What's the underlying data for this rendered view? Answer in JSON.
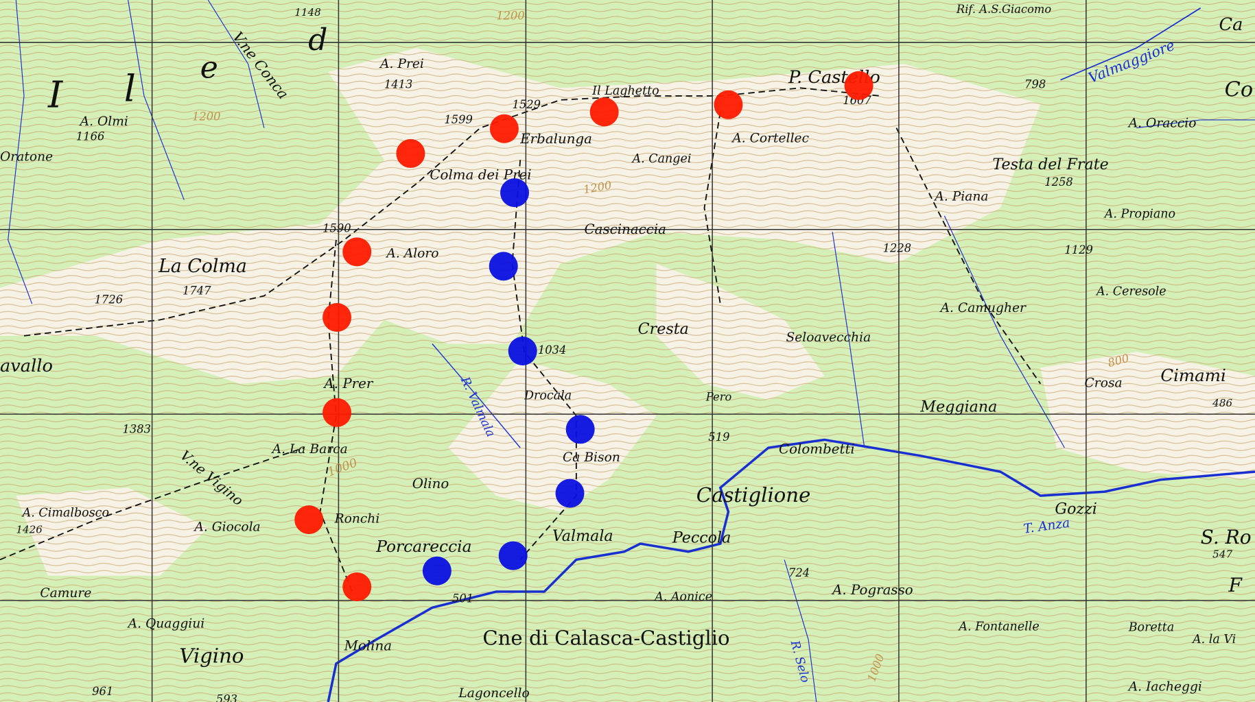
{
  "map": {
    "colors": {
      "land": "#d4f0b8",
      "rock": "#f6f3e6",
      "contour": "#c9a36a",
      "water": "#1a2fd0",
      "grid": "#333333",
      "marker_red": "#ff1a00",
      "marker_blue": "#0a10e0"
    },
    "markers_red_count": 10,
    "markers_blue_count": 7,
    "labels": [
      "I",
      "l",
      "e",
      "d",
      "V.ne Conca",
      "1148",
      "A. Prei",
      "1413",
      "1200",
      "1200",
      "A. Olmi",
      "1166",
      "Oratone",
      "Il Laghetto",
      "1529",
      "1599",
      "Erbalunga",
      "Colma dei Prei",
      "A. Cangei",
      "A. Cortellec",
      "P. Castello",
      "1607",
      "798",
      "Valmaggiore",
      "Ca",
      "Co",
      "Rif. A.S.Giacomo",
      "A. Oraccio",
      "Testa del Frate",
      "1258",
      "A. Piana",
      "1200",
      "Cascinaccia",
      "A. Propiano",
      "1129",
      "1228",
      "1590",
      "La Colma",
      "A. Aloro",
      "1747",
      "1726",
      "A. Ceresole",
      "A. Camugher",
      "Cresta",
      "Seloavecchia",
      "1034",
      "avallo",
      "A. Prer",
      "800",
      "Crosa",
      "Cimami",
      "Drocala",
      "Pero",
      "Meggiana",
      "486",
      "1383",
      "R. Valmala",
      "519",
      "Colombetti",
      "A. La Barca",
      "Ca Bison",
      "Castiglione",
      "Gozzi",
      "T. Anza",
      "Olino",
      "1000",
      "V.ne Vigino",
      "A. Cimalbosco",
      "1426",
      "A. Giocola",
      "Ronchi",
      "Porcareccia",
      "Valmala",
      "Peccola",
      "S. Ro",
      "547",
      "F",
      "724",
      "A. Pograsso",
      "Camure",
      "501",
      "A. Aonice",
      "A. Quaggiui",
      "Vigino",
      "Molina",
      "Cne di Calasca-Castiglio",
      "A. Fontanelle",
      "Boretta",
      "A. la Vi",
      "R. Selo",
      "961",
      "593",
      "Lagoncello",
      "A. Iacheggi",
      "1000"
    ]
  }
}
